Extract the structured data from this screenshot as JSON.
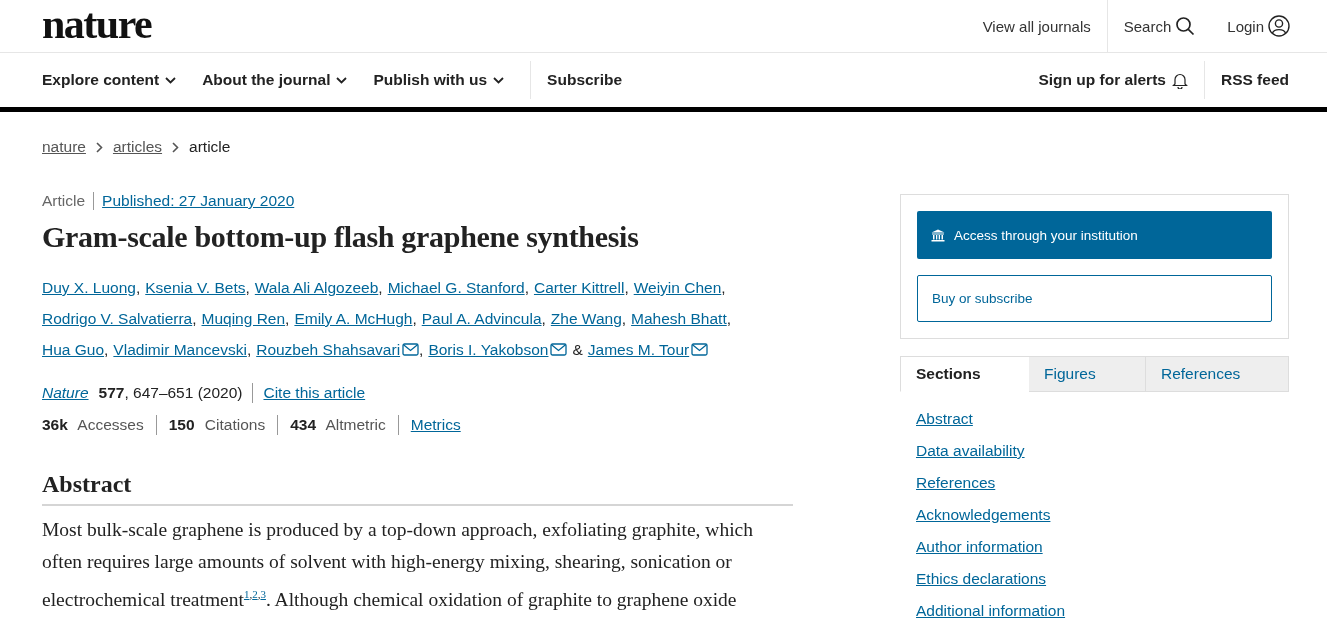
{
  "header": {
    "logo": "nature",
    "links": [
      {
        "label": "View all journals"
      },
      {
        "label": "Search"
      },
      {
        "label": "Login"
      }
    ]
  },
  "nav": {
    "items": [
      {
        "label": "Explore content",
        "dropdown": true
      },
      {
        "label": "About the journal",
        "dropdown": true
      },
      {
        "label": "Publish with us",
        "dropdown": true
      },
      {
        "label": "Subscribe",
        "dropdown": false
      }
    ],
    "right": [
      {
        "label": "Sign up for alerts"
      },
      {
        "label": "RSS feed"
      }
    ]
  },
  "breadcrumb": [
    {
      "label": "nature",
      "link": true
    },
    {
      "label": "articles",
      "link": true
    },
    {
      "label": "article",
      "link": false
    }
  ],
  "article": {
    "type": "Article",
    "published": "Published: 27 January 2020",
    "title": "Gram-scale bottom-up flash graphene synthesis",
    "authors": [
      {
        "name": "Duy X. Luong",
        "email": false,
        "sep": ","
      },
      {
        "name": "Ksenia V. Bets",
        "email": false,
        "sep": ","
      },
      {
        "name": "Wala Ali Algozeeb",
        "email": false,
        "sep": ","
      },
      {
        "name": "Michael G. Stanford",
        "email": false,
        "sep": ","
      },
      {
        "name": "Carter Kittrell",
        "email": false,
        "sep": ","
      },
      {
        "name": "Weiyin Chen",
        "email": false,
        "sep": ","
      },
      {
        "name": "Rodrigo V. Salvatierra",
        "email": false,
        "sep": ","
      },
      {
        "name": "Muqing Ren",
        "email": false,
        "sep": ","
      },
      {
        "name": "Emily A. McHugh",
        "email": false,
        "sep": ","
      },
      {
        "name": "Paul A. Advincula",
        "email": false,
        "sep": ","
      },
      {
        "name": "Zhe Wang",
        "email": false,
        "sep": ","
      },
      {
        "name": "Mahesh Bhatt",
        "email": false,
        "sep": ","
      },
      {
        "name": "Hua Guo",
        "email": false,
        "sep": ","
      },
      {
        "name": "Vladimir Mancevski",
        "email": false,
        "sep": ","
      },
      {
        "name": "Rouzbeh Shahsavari",
        "email": true,
        "sep": ","
      },
      {
        "name": "Boris I. Yakobson",
        "email": true,
        "sep": "&"
      },
      {
        "name": "James M. Tour",
        "email": true
      }
    ],
    "journal": "Nature",
    "citation": "**577**, 647–651 (2020)",
    "cite_link": "Cite this article",
    "stats": [
      "**36k** Accesses",
      "**150** Citations",
      "**434** Altmetric"
    ],
    "metrics_link": "Metrics",
    "abstract_heading": "Abstract",
    "abstract_before": "Most bulk-scale graphene is produced by a top-down approach, exfoliating graphite, which often requires large amounts of solvent with high-energy mixing, shearing, sonication or electrochemical treatment",
    "abstract_refs": [
      {
        "ref": "1",
        "sep": ","
      },
      {
        "ref": "2",
        "sep": ","
      },
      {
        "ref": "3"
      }
    ],
    "abstract_after": ". Although chemical oxidation of graphite to graphene oxide"
  },
  "access": {
    "primary": "Access through your institution",
    "secondary": "Buy or subscribe"
  },
  "tabs": [
    {
      "label": "Sections",
      "selected": true
    },
    {
      "label": "Figures",
      "selected": false
    },
    {
      "label": "References",
      "selected": false
    }
  ],
  "sections": [
    "Abstract",
    "Data availability",
    "References",
    "Acknowledgements",
    "Author information",
    "Ethics declarations",
    "Additional information"
  ]
}
